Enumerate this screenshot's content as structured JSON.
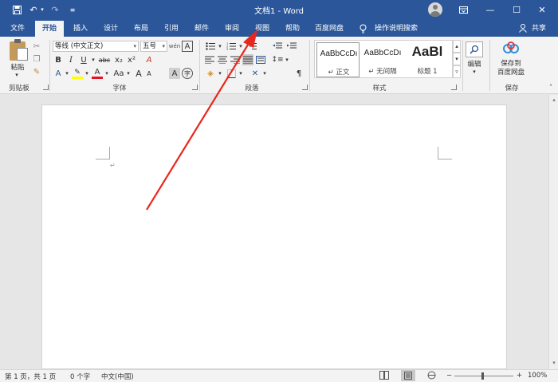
{
  "titlebar": {
    "title": "文档1  -  Word",
    "save_icon": "save-icon",
    "undo_icon": "undo-icon",
    "redo_icon": "redo-icon",
    "customize_icon": "customize-qat-icon",
    "restore_icon": "ribbon-display-icon",
    "minimize": "—",
    "maximize": "☐",
    "close": "✕"
  },
  "tabs": [
    "文件",
    "开始",
    "插入",
    "设计",
    "布局",
    "引用",
    "邮件",
    "审阅",
    "视图",
    "帮助",
    "百度网盘"
  ],
  "active_tab": "开始",
  "tell_me": "操作说明搜索",
  "share": "共享",
  "ribbon": {
    "clipboard": {
      "paste": "粘贴",
      "label": "剪贴板"
    },
    "font": {
      "font_name": "等线 (中文正文)",
      "font_size": "五号",
      "label": "字体",
      "bold": "B",
      "italic": "I",
      "underline": "U",
      "strike": "abc",
      "subscript": "x₂",
      "superscript": "x²",
      "font_color": "A",
      "change_case": "Aa",
      "grow": "A",
      "shrink": "A"
    },
    "paragraph": {
      "label": "段落"
    },
    "styles": {
      "label": "样式",
      "items": [
        {
          "sample": "AaBbCcDı",
          "name": "↵ 正文"
        },
        {
          "sample": "AaBbCcDı",
          "name": "↵ 无间隔"
        },
        {
          "sample": "AaBl",
          "name": "标题 1"
        }
      ]
    },
    "editing": {
      "label": "编辑"
    },
    "save": {
      "button": "保存到\n百度网盘",
      "label": "保存"
    }
  },
  "document": {
    "paragraph_mark": "↵"
  },
  "statusbar": {
    "page": "第 1 页，共 1 页",
    "words": "0 个字",
    "language": "中文(中国)",
    "zoom": "100%"
  },
  "colors": {
    "accent": "#2b579a",
    "annotation_arrow": "#e8281e",
    "font_color_bar": "#e81123",
    "highlight_bar": "#ffff00"
  }
}
